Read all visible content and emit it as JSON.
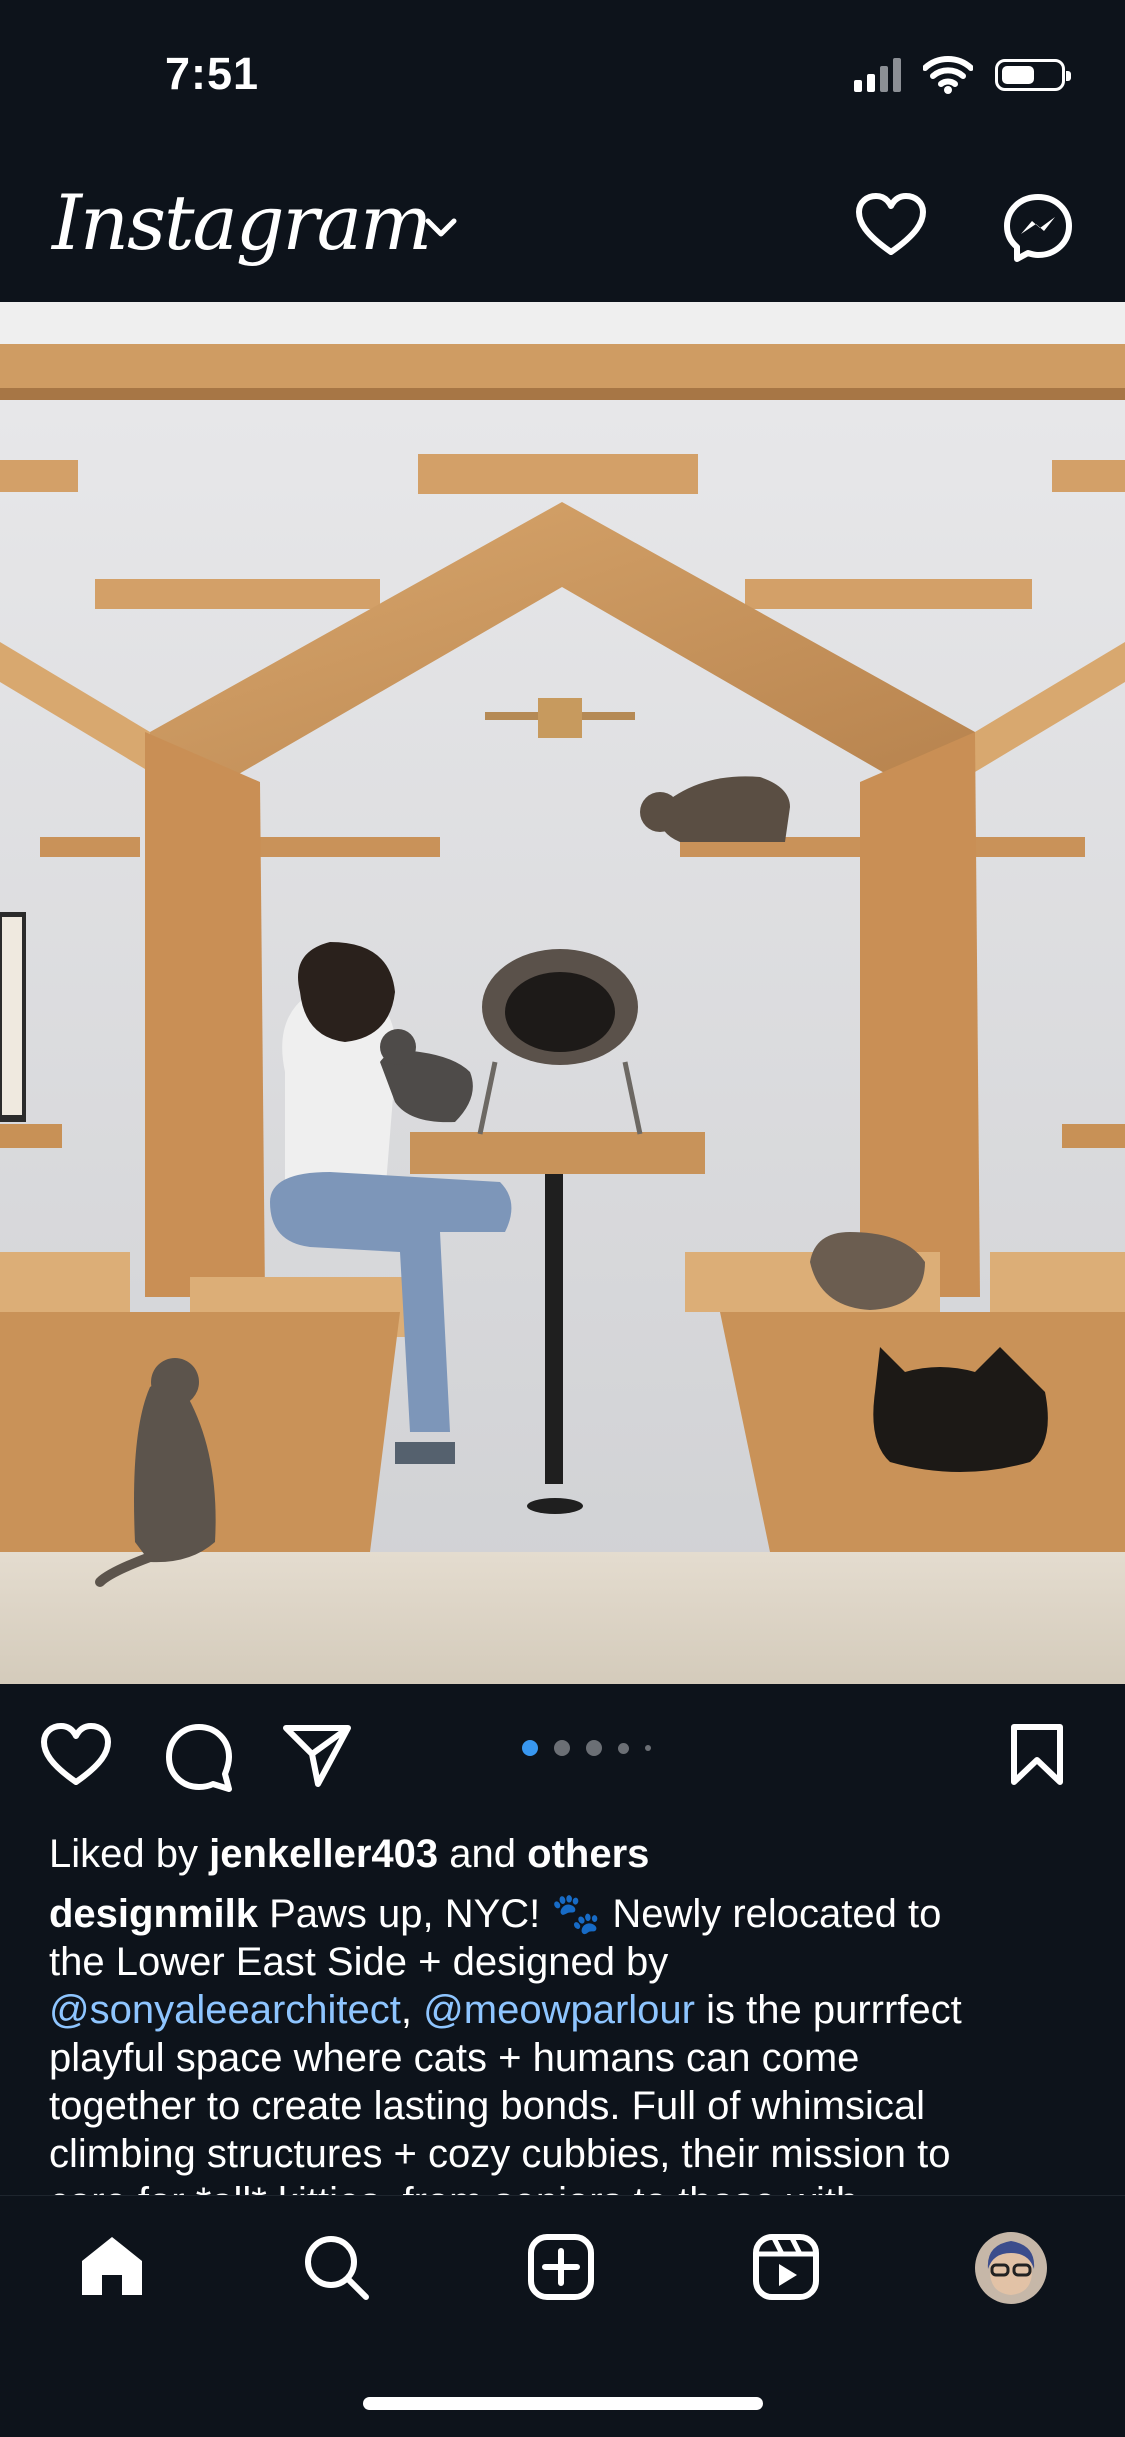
{
  "status_bar": {
    "time": "7:51"
  },
  "header": {
    "logo": "Instagram"
  },
  "post": {
    "carousel": {
      "count": 5,
      "active_index": 0
    },
    "likes": {
      "prefix": "Liked by",
      "user": "jenkeller403",
      "middle": "and",
      "suffix": "others"
    },
    "caption": {
      "username": "designmilk",
      "line1_text": "Paws up, NYC! 🐾 Newly relocated to",
      "line2": "the Lower East Side + designed by",
      "mention1": "@sonyaleearchitect",
      "separator": ",",
      "mention2": "@meowparlour",
      "line3_rest": "is the purrrfect",
      "line4": "playful space where cats + humans can come",
      "line5": "together to create lasting bonds. Full of whimsical",
      "line6": "climbing structures + cozy cubbies, their mission to",
      "line7": "care for *all* kitties, from seniors to those with"
    }
  },
  "icons": {
    "heart": "heart-icon",
    "messenger": "messenger-icon",
    "like": "like-icon",
    "comment": "comment-icon",
    "share": "share-icon",
    "save": "bookmark-icon",
    "home": "home-icon",
    "search": "search-icon",
    "create": "create-icon",
    "reels": "reels-icon",
    "profile": "avatar"
  },
  "colors": {
    "background": "#0d131b",
    "mention": "#8ec5ff",
    "dot_active": "#3897f0"
  }
}
